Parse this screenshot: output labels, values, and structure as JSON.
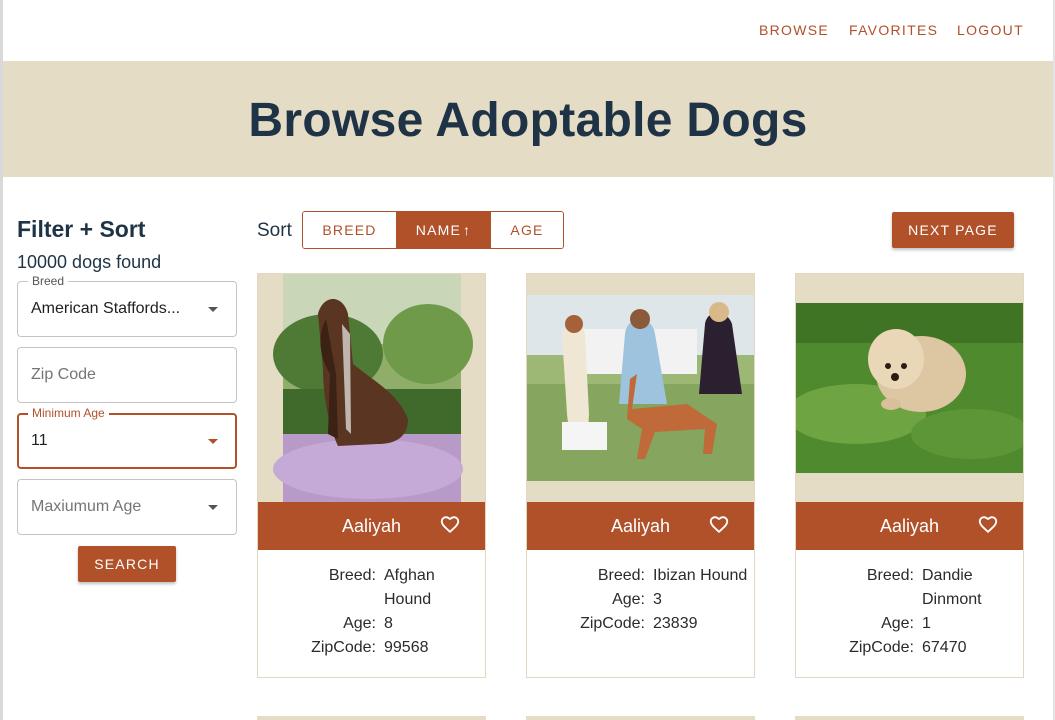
{
  "nav": {
    "browse": "BROWSE",
    "favorites": "FAVORITES",
    "logout": "LOGOUT"
  },
  "hero": {
    "title": "Browse Adoptable Dogs"
  },
  "filters": {
    "title": "Filter + Sort",
    "count_text": "10000 dogs found",
    "breed": {
      "label": "Breed",
      "value": "American Staffords..."
    },
    "zip": {
      "placeholder": "Zip Code"
    },
    "min_age": {
      "label": "Minimum Age",
      "value": "11"
    },
    "max_age": {
      "placeholder": "Maxiumum Age"
    },
    "search_label": "SEARCH"
  },
  "sort": {
    "label": "Sort",
    "options": [
      "BREED",
      "NAME",
      "AGE"
    ],
    "active": "NAME",
    "direction_icon": "arrow-up-icon"
  },
  "pagination": {
    "next_label": "NEXT PAGE"
  },
  "info_labels": {
    "breed": "Breed:",
    "age": "Age:",
    "zip": "ZipCode:"
  },
  "dogs": [
    {
      "name": "Aaliyah",
      "breed": "Afghan Hound",
      "age": "8",
      "zip": "99568",
      "photo_icon": "dog-photo"
    },
    {
      "name": "Aaliyah",
      "breed": "Ibizan Hound",
      "age": "3",
      "zip": "23839",
      "photo_icon": "dog-photo"
    },
    {
      "name": "Aaliyah",
      "breed": "Dandie Dinmont",
      "age": "1",
      "zip": "67470",
      "photo_icon": "dog-photo"
    }
  ],
  "colors": {
    "accent": "#b0512a",
    "hero_bg": "#e5dcc5",
    "heading": "#1f3346"
  }
}
